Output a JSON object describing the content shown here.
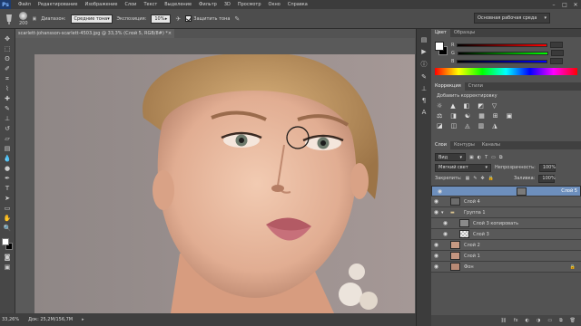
{
  "menu": {
    "logo": "Ps",
    "items": [
      "Файл",
      "Редактирование",
      "Изображение",
      "Слои",
      "Текст",
      "Выделение",
      "Фильтр",
      "3D",
      "Просмотр",
      "Окно",
      "Справка"
    ]
  },
  "window_controls": {
    "minimize": "–",
    "maximize": "□",
    "close": "✕"
  },
  "options": {
    "brush_size": "200",
    "range_label": "Диапазон:",
    "range_value": "Средние тона",
    "exposure_label": "Экспозиция:",
    "exposure_value": "10%",
    "protect_tones_label": "Защитить тона",
    "workspace": "Основная рабочая среда"
  },
  "document": {
    "tab_title": "scarlett-johansson-scarlett-4503.jpg @ 33,3% (Слой 5, RGB/8#) *",
    "tab_close": "×"
  },
  "status": {
    "zoom": "33,26%",
    "doc_size": "Док: 25,2М/156,7М"
  },
  "color_panel": {
    "tabs": [
      "Цвет",
      "Образцы"
    ],
    "channels": [
      "R",
      "G",
      "B"
    ],
    "values": [
      "",
      "",
      ""
    ]
  },
  "adjustments_panel": {
    "tabs": [
      "Коррекция",
      "Стили"
    ],
    "add_label": "Добавить корректировку",
    "row1_icons": [
      "☼",
      "▲",
      "◧",
      "◩",
      "▽"
    ],
    "row2_icons": [
      "⚖",
      "◨",
      "☯",
      "▦",
      "⊞",
      "▣"
    ],
    "row3_icons": [
      "◪",
      "◫",
      "◬",
      "▥",
      "◮"
    ]
  },
  "layers_panel": {
    "tabs": [
      "Слои",
      "Контуры",
      "Каналы"
    ],
    "kind_value": "Вид",
    "blend_mode": "Мягкий свет",
    "opacity_label": "Непрозрачность:",
    "opacity_value": "100%",
    "lock_label": "Закрепить:",
    "fill_label": "Заливка:",
    "fill_value": "100%",
    "layers": [
      {
        "name": "Слой 5"
      },
      {
        "name": "Слой 4"
      },
      {
        "name": "Группа 1"
      },
      {
        "name": "Слой 3 копировать"
      },
      {
        "name": "Слой 3"
      },
      {
        "name": "Слой 2"
      },
      {
        "name": "Слой 1"
      },
      {
        "name": "Фон"
      }
    ],
    "footer_icons": [
      "⛓",
      "fx",
      "◐",
      "◑",
      "▭",
      "⧉",
      "🗑"
    ]
  },
  "colors": {
    "accent_selected": "#6d8fbd",
    "menubar": "#3c3c3c",
    "panel": "#535353"
  }
}
